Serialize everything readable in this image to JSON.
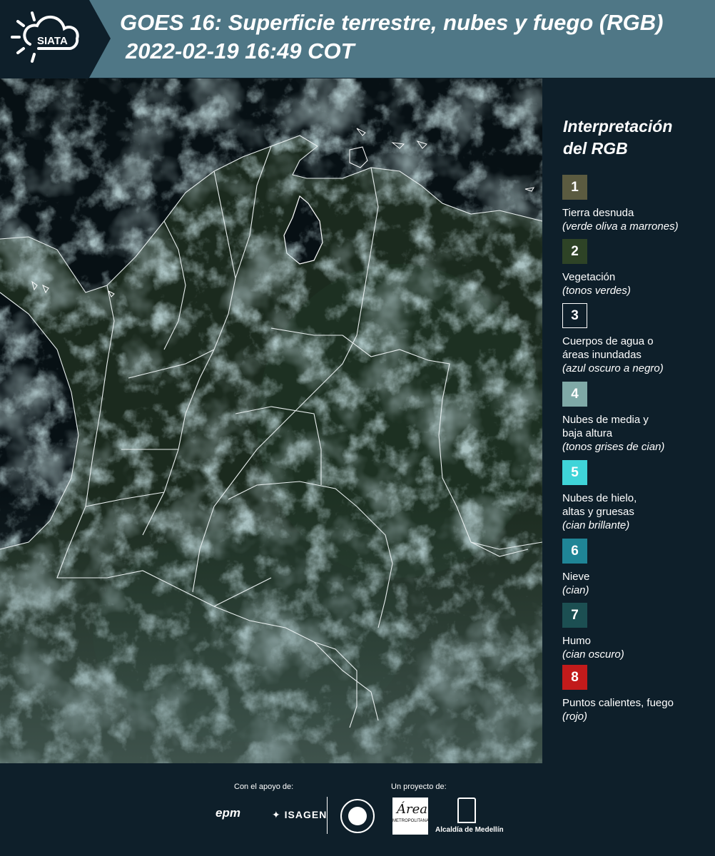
{
  "header": {
    "logo_text": "SIATA",
    "title_line1": "GOES 16: Superficie terrestre, nubes y fuego (RGB)",
    "title_line2": "2022-02-19 16:49 COT"
  },
  "legend": {
    "title_line1": "Interpretación",
    "title_line2": "del RGB",
    "items": [
      {
        "num": "1",
        "color": "#5b5b40",
        "line1": "Tierra desnuda",
        "line2": "",
        "italic": "(verde oliva a marrones)"
      },
      {
        "num": "2",
        "color": "#2e4326",
        "line1": "Vegetación",
        "line2": "",
        "italic": "(tonos verdes)"
      },
      {
        "num": "3",
        "color": "#0e1f2a",
        "line1": "Cuerpos de agua o",
        "line2": "áreas inundadas",
        "italic": "(azul oscuro a negro)"
      },
      {
        "num": "4",
        "color": "#7fa9a7",
        "line1": "Nubes de media y",
        "line2": "baja altura",
        "italic": "(tonos grises de cian)"
      },
      {
        "num": "5",
        "color": "#3fd4d8",
        "line1": "Nubes de hielo,",
        "line2": "altas y gruesas",
        "italic": "(cian brillante)"
      },
      {
        "num": "6",
        "color": "#1f8596",
        "line1": "Nieve",
        "line2": "",
        "italic": "(cian)"
      },
      {
        "num": "7",
        "color": "#1c4f52",
        "line1": "Humo",
        "line2": "",
        "italic": "(cian oscuro)"
      },
      {
        "num": "8",
        "color": "#c21b1b",
        "line1": "Puntos calientes, fuego",
        "line2": "",
        "italic": "(rojo)"
      }
    ]
  },
  "footer": {
    "support_label": "Con el apoyo de:",
    "project_label": "Un proyecto de:",
    "epm": "epm",
    "isagen": "ISAGEN",
    "area_word": "Área",
    "area_sub": "METROPOLITANA",
    "alcaldia": "Alcaldía de Medellín"
  }
}
